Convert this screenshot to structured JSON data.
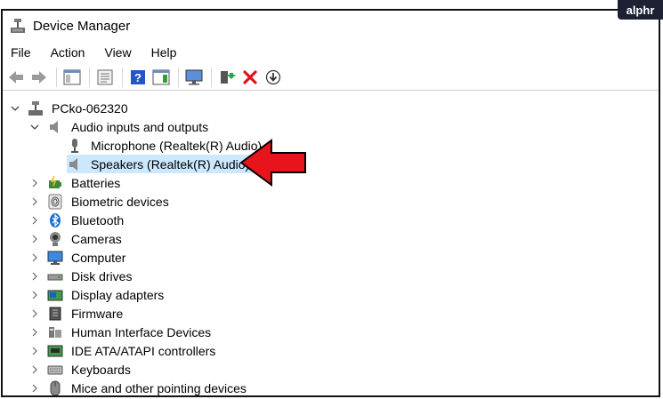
{
  "window": {
    "title": "Device Manager"
  },
  "menu": [
    "File",
    "Action",
    "View",
    "Help"
  ],
  "toolbar": {
    "icons": [
      "back-icon",
      "forward-icon",
      "show-hide-tree-icon",
      "properties-icon",
      "help-icon",
      "action-pane-icon",
      "scan-hardware-icon",
      "update-driver-icon",
      "uninstall-icon",
      "disable-device-icon"
    ]
  },
  "tree": {
    "root": "PCko-062320",
    "audio_category": "Audio inputs and outputs",
    "audio_children": [
      "Microphone (Realtek(R) Audio)",
      "Speakers (Realtek(R) Audio)"
    ],
    "categories": [
      "Batteries",
      "Biometric devices",
      "Bluetooth",
      "Cameras",
      "Computer",
      "Disk drives",
      "Display adapters",
      "Firmware",
      "Human Interface Devices",
      "IDE ATA/ATAPI controllers",
      "Keyboards",
      "Mice and other pointing devices"
    ]
  },
  "colors": {
    "selection": "#cce8ff",
    "arrow": "#e8141b",
    "badge_bg": "#1e2133"
  },
  "badge": "alphr"
}
